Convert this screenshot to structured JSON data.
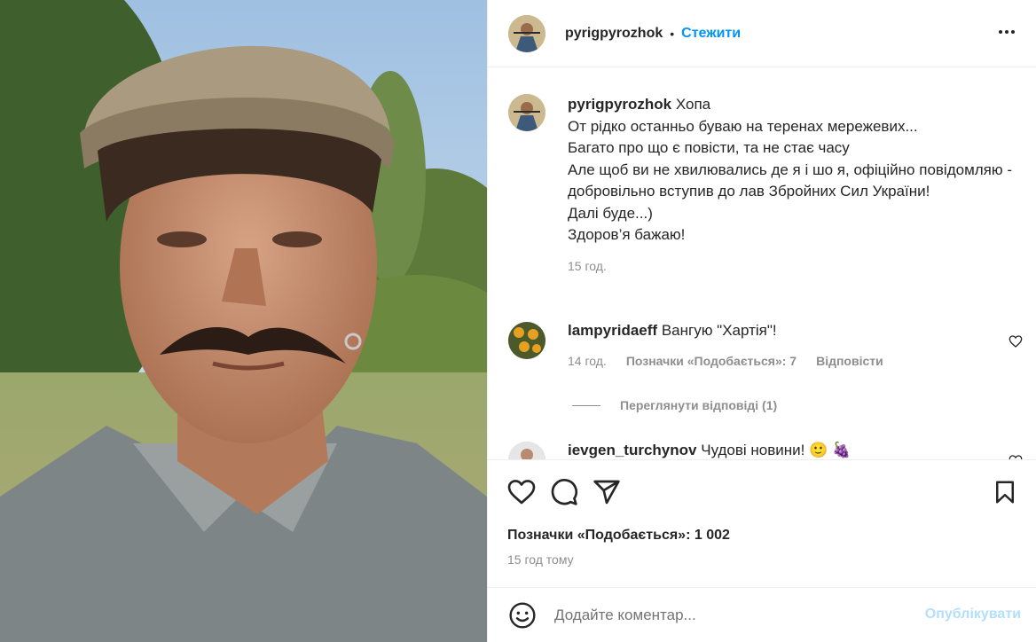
{
  "post": {
    "username": "pyrigpyrozhok",
    "follow_label": "Стежити",
    "separator": "•"
  },
  "caption": {
    "username": "pyrigpyrozhok",
    "lines": [
      "Хопа",
      "От рідко останньо буваю на теренах мережевих...",
      "Багато про що є повісти, та не стає часу",
      "Але щоб ви не хвилювались де я і шо я, офіційно повідомляю - добровільно вступив до лав Збройних Сил України!",
      "Далі буде...)",
      "Здоров’я бажаю!"
    ],
    "time": "15 год."
  },
  "comments": [
    {
      "username": "lampyridaeff",
      "text": "Вангую \"Хартія\"!",
      "time": "14 год.",
      "likes": "Позначки «Подобається»: 7",
      "reply": "Відповісти"
    },
    {
      "username": "ievgen_turchynov",
      "text": "Чудові новини! 🙂 🍇"
    }
  ],
  "view_replies": "Переглянути відповіді (1)",
  "actions": {
    "likes_count": "Позначки «Подобається»: 1 002",
    "posted_time": "15 год тому"
  },
  "composer": {
    "placeholder": "Додайте коментар...",
    "publish_label": "Опублікувати"
  },
  "icons": {
    "like": "heart-icon",
    "comment": "comment-icon",
    "share": "share-icon",
    "save": "bookmark-icon",
    "options": "more-options-icon",
    "emoji": "emoji-icon"
  },
  "colors": {
    "accent": "#0095f6",
    "publish_disabled": "#b2dffc",
    "secondary_text": "#8e8e8e"
  }
}
